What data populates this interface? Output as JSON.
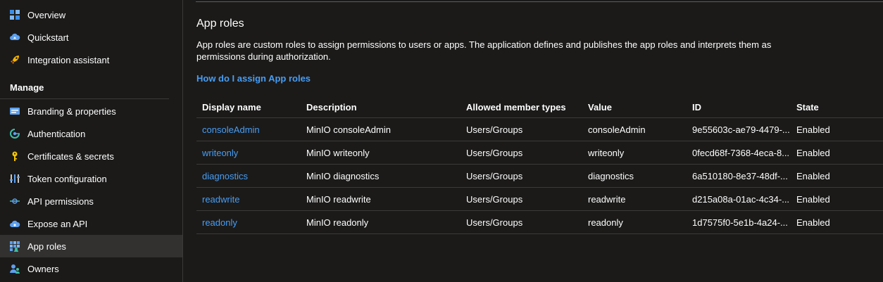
{
  "sidebar": {
    "items_top": [
      {
        "label": "Overview",
        "icon": "overview-grid-icon"
      },
      {
        "label": "Quickstart",
        "icon": "quickstart-cloud-icon"
      },
      {
        "label": "Integration assistant",
        "icon": "rocket-icon"
      }
    ],
    "section_title": "Manage",
    "items_manage": [
      {
        "label": "Branding & properties",
        "icon": "branding-icon"
      },
      {
        "label": "Authentication",
        "icon": "authentication-icon"
      },
      {
        "label": "Certificates & secrets",
        "icon": "key-icon"
      },
      {
        "label": "Token configuration",
        "icon": "token-bars-icon"
      },
      {
        "label": "API permissions",
        "icon": "api-permissions-icon"
      },
      {
        "label": "Expose an API",
        "icon": "cloud-api-icon"
      },
      {
        "label": "App roles",
        "icon": "app-roles-icon",
        "selected": true
      },
      {
        "label": "Owners",
        "icon": "owners-icon"
      }
    ]
  },
  "main": {
    "title": "App roles",
    "description": "App roles are custom roles to assign permissions to users or apps. The application defines and publishes the app roles and interprets them as permissions during authorization.",
    "help_link": "How do I assign App roles",
    "table": {
      "columns": [
        "Display name",
        "Description",
        "Allowed member types",
        "Value",
        "ID",
        "State"
      ],
      "rows": [
        [
          "consoleAdmin",
          "MinIO consoleAdmin",
          "Users/Groups",
          "consoleAdmin",
          "9e55603c-ae79-4479-...",
          "Enabled"
        ],
        [
          "writeonly",
          "MinIO writeonly",
          "Users/Groups",
          "writeonly",
          "0fecd68f-7368-4eca-8...",
          "Enabled"
        ],
        [
          "diagnostics",
          "MinIO diagnostics",
          "Users/Groups",
          "diagnostics",
          "6a510180-8e37-48df-...",
          "Enabled"
        ],
        [
          "readwrite",
          "MinIO readwrite",
          "Users/Groups",
          "readwrite",
          "d215a08a-01ac-4c34-...",
          "Enabled"
        ],
        [
          "readonly",
          "MinIO readonly",
          "Users/Groups",
          "readonly",
          "1d7575f0-5e1b-4a24-...",
          "Enabled"
        ]
      ]
    }
  },
  "colors": {
    "background": "#1b1a19",
    "selected": "#323130",
    "link": "#479ef5",
    "divider": "#3b3a39"
  }
}
